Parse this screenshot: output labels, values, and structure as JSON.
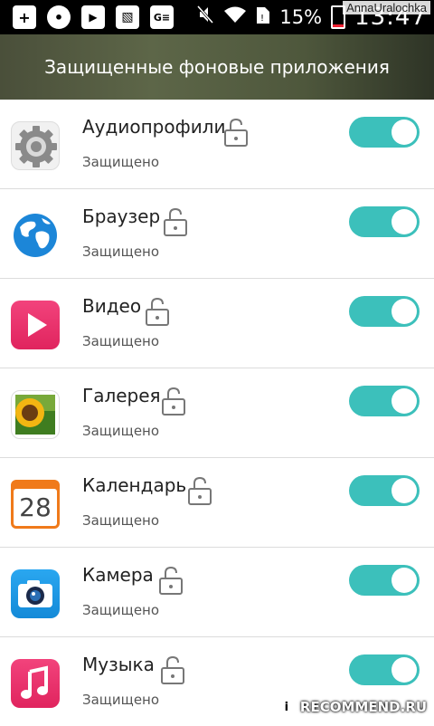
{
  "status_bar": {
    "battery_percent": "15%",
    "time": "13:47",
    "icons": [
      "add-icon",
      "chat-icon",
      "youtube-icon",
      "image-icon",
      "ge-icon",
      "mute-icon",
      "wifi-icon",
      "sim-icon",
      "battery-icon"
    ]
  },
  "watermark_top": "AnnaUralochka",
  "header": {
    "title": "Защищенные фоновые приложения"
  },
  "apps": [
    {
      "name": "Аудиопрофили",
      "status": "Защищено",
      "icon": "settings-gear-icon",
      "enabled": true
    },
    {
      "name": "Браузер",
      "status": "Защищено",
      "icon": "globe-icon",
      "enabled": true
    },
    {
      "name": "Видео",
      "status": "Защищено",
      "icon": "play-video-icon",
      "enabled": true
    },
    {
      "name": "Галерея",
      "status": "Защищено",
      "icon": "sunflower-gallery-icon",
      "enabled": true
    },
    {
      "name": "Календарь",
      "status": "Защищено",
      "icon": "calendar-icon",
      "calendar_day": "28",
      "enabled": true
    },
    {
      "name": "Камера",
      "status": "Защищено",
      "icon": "camera-icon",
      "enabled": true
    },
    {
      "name": "Музыка",
      "status": "Защищено",
      "icon": "music-note-icon",
      "enabled": true
    }
  ],
  "watermark_bottom": "RECOMMEND.RU",
  "colors": {
    "toggle_on": "#3cc0bb",
    "header_bg": "#55603f"
  }
}
